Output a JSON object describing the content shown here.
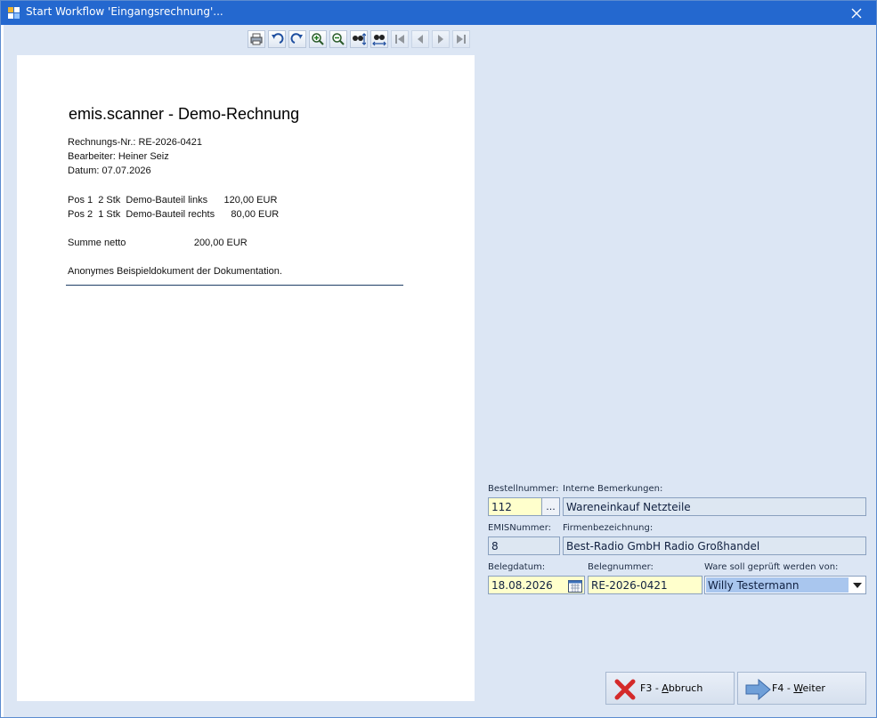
{
  "window": {
    "title": "Start Workflow 'Eingangsrechnung'..."
  },
  "toolbar": {
    "buttons": [
      {
        "icon": "print-icon"
      },
      {
        "icon": "rotate-left-icon"
      },
      {
        "icon": "rotate-right-icon"
      },
      {
        "icon": "zoom-in-icon"
      },
      {
        "icon": "zoom-out-icon"
      },
      {
        "icon": "fit-height-icon"
      },
      {
        "icon": "fit-width-icon"
      },
      {
        "icon": "first-page-icon",
        "disabled": true
      },
      {
        "icon": "previous-page-icon",
        "disabled": true
      },
      {
        "icon": "next-page-icon",
        "disabled": true
      },
      {
        "icon": "last-page-icon",
        "disabled": true
      }
    ]
  },
  "document": {
    "title": "emis.scanner - Demo-Rechnung",
    "lines": [
      "Rechnungs-Nr.: RE-2026-0421",
      "Bearbeiter: Heiner Seiz",
      "Datum: 07.07.2026",
      "Pos 1  2 Stk  Demo-Bauteil links      120,00 EUR",
      "Pos 2  1 Stk  Demo-Bauteil rechts      80,00 EUR",
      "Summe netto                         200,00 EUR",
      "Anonymes Beispieldokument der Dokumentation."
    ]
  },
  "form": {
    "bestellnummer": {
      "label": "Bestellnummer:",
      "value": "112",
      "lookup_label": "..."
    },
    "bemerkungen": {
      "label": "Interne Bemerkungen:",
      "value": "Wareneinkauf Netzteile"
    },
    "emisnummer": {
      "label": "EMISNummer:",
      "value": "8"
    },
    "firmenbezeichnung": {
      "label": "Firmenbezeichnung:",
      "value": "Best-Radio GmbH Radio Großhandel"
    },
    "belegdatum": {
      "label": "Belegdatum:",
      "value": "18.08.2026"
    },
    "belegnummer": {
      "label": "Belegnummer:",
      "value": "RE-2026-0421"
    },
    "pruefer": {
      "label": "Ware soll geprüft werden von:",
      "value": "Willy Testermann"
    }
  },
  "buttons": {
    "cancel": {
      "pre": "F3 - ",
      "key": "A",
      "rest": "bbruch"
    },
    "next": {
      "pre": "F4 - ",
      "key": "W",
      "rest": "eiter"
    }
  },
  "colors": {
    "titlebar": "#2468cf",
    "dialog_bg": "#dce6f4",
    "required_field": "#ffffcc",
    "readonly_field": "#dde7f2",
    "selection": "#a9c6ee"
  }
}
